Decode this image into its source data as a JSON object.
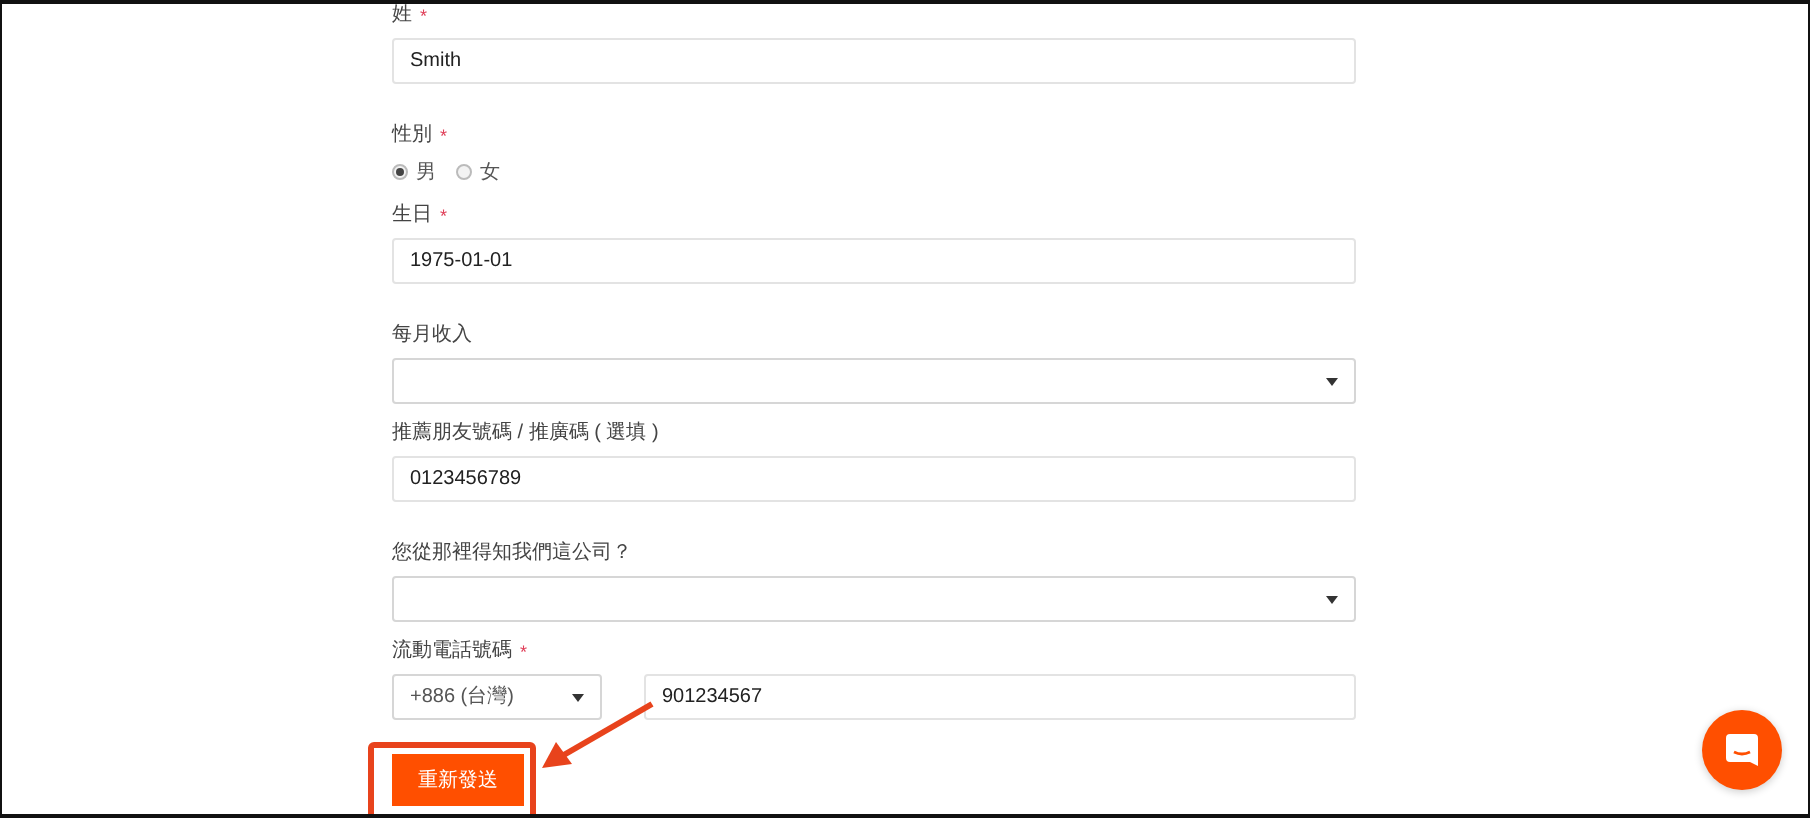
{
  "fields": [
    {
      "kind": "text",
      "label": "姓",
      "required_mark": "*",
      "value": "Smith"
    },
    {
      "kind": "radio",
      "label": "性別",
      "required_mark": "*",
      "options": [
        {
          "label": "男",
          "selected": true
        },
        {
          "label": "女",
          "selected": false
        }
      ]
    },
    {
      "kind": "text",
      "label": "生日",
      "required_mark": "*",
      "value": "1975-01-01"
    },
    {
      "kind": "select",
      "label": "每月收入"
    },
    {
      "kind": "text",
      "label": "推薦朋友號碼 / 推廣碼 ( 選填 )",
      "value": "0123456789"
    },
    {
      "kind": "select",
      "label": "您從那裡得知我們這公司？"
    },
    {
      "kind": "phone",
      "label": "流動電話號碼",
      "required_mark": "*",
      "country": "+886 (台灣)",
      "value": "901234567"
    }
  ],
  "submit": {
    "label": "重新發送",
    "highlighted": true
  }
}
